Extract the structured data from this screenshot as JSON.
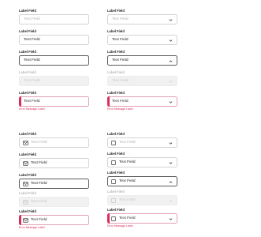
{
  "colors": {
    "error": "#d92e5b",
    "border": "#d3d3d3",
    "disabled_bg": "#f1f1f1",
    "focus_border": "#5a5a5a"
  },
  "section1": {
    "text_fields": [
      {
        "label": "Label Field",
        "value": "Text Field",
        "state": "default"
      },
      {
        "label": "Label Field",
        "value": "Text Field",
        "state": "filled"
      },
      {
        "label": "Label Field",
        "value": "Text Field",
        "state": "focused"
      },
      {
        "label": "Label Field",
        "value": "Text Field",
        "state": "disabled"
      },
      {
        "label": "Label Field",
        "value": "Text Field",
        "state": "error",
        "error": "Error Message Label"
      }
    ],
    "dropdowns": [
      {
        "label": "Label Field",
        "value": "Text Field",
        "state": "default",
        "icon": "chevron-down-icon"
      },
      {
        "label": "Label Field",
        "value": "Text Field",
        "state": "filled",
        "icon": "chevron-down-icon"
      },
      {
        "label": "Label Field",
        "value": "Text Field",
        "state": "open",
        "icon": "chevron-up-icon"
      },
      {
        "label": "Label Field",
        "value": "Text Field",
        "state": "disabled",
        "icon": "chevron-down-icon"
      },
      {
        "label": "Label Field",
        "value": "Text Field",
        "state": "error",
        "icon": "chevron-down-icon",
        "error": "Error Message Label"
      }
    ]
  },
  "section2": {
    "icon_fields": [
      {
        "label": "Label Field",
        "value": "Text Field",
        "state": "default",
        "icon": "mail-icon"
      },
      {
        "label": "Label Field",
        "value": "Text Field",
        "state": "filled",
        "icon": "mail-icon"
      },
      {
        "label": "Label Field",
        "value": "Text Field",
        "state": "focused",
        "icon": "mail-icon"
      },
      {
        "label": "Label Field",
        "value": "Text Field",
        "state": "disabled",
        "icon": "mail-icon"
      },
      {
        "label": "Label Field",
        "value": "Text Field",
        "state": "error",
        "icon": "mail-icon",
        "error": "Error Message Label"
      }
    ],
    "checkbox_dropdowns": [
      {
        "label": "Label Field",
        "value": "Text Field",
        "state": "default",
        "icon": "chevron-down-icon"
      },
      {
        "label": "Label Field",
        "value": "Text Field",
        "state": "filled",
        "icon": "chevron-down-icon"
      },
      {
        "label": "Label Field",
        "value": "Text Field",
        "state": "open",
        "icon": "chevron-up-icon"
      },
      {
        "label": "Label Field",
        "value": "Text Field",
        "state": "disabled",
        "icon": "chevron-down-icon"
      },
      {
        "label": "Label Field",
        "value": "Text Field",
        "state": "error",
        "icon": "chevron-down-icon",
        "error": "Error Message Label"
      }
    ]
  }
}
